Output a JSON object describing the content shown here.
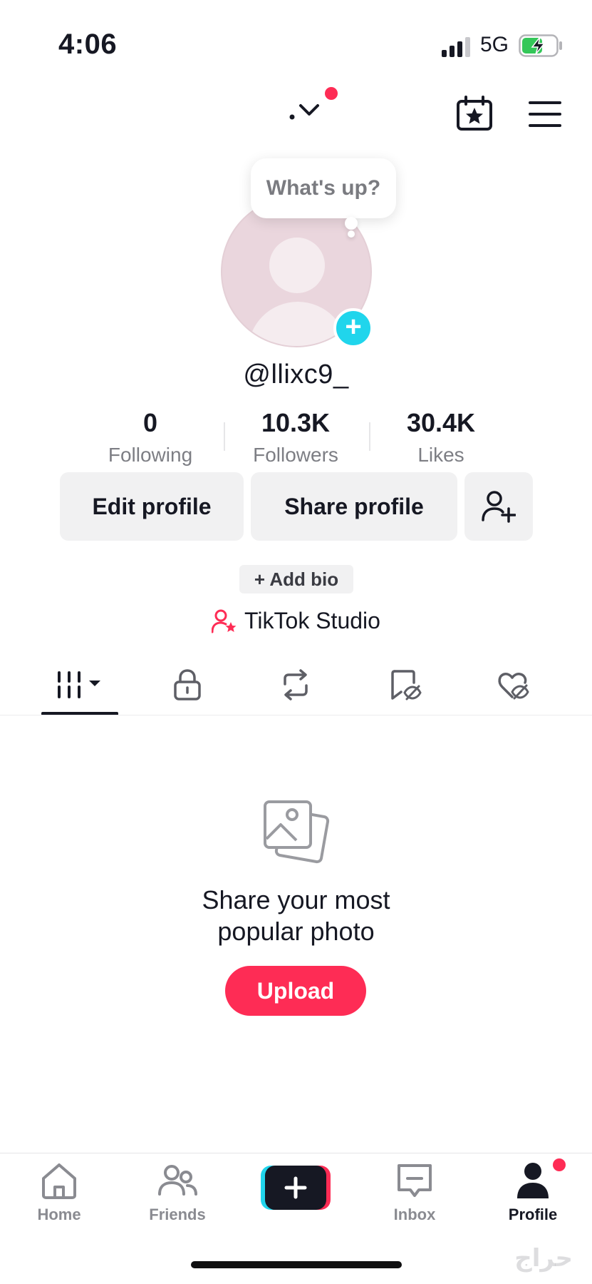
{
  "status_bar": {
    "time": "4:06",
    "network": "5G"
  },
  "bubble": {
    "text": "What's up?"
  },
  "profile": {
    "username": "@llixc9_",
    "stats": [
      {
        "value": "0",
        "label": "Following"
      },
      {
        "value": "10.3K",
        "label": "Followers"
      },
      {
        "value": "30.4K",
        "label": "Likes"
      }
    ],
    "edit_label": "Edit profile",
    "share_label": "Share profile",
    "add_bio_label": "+ Add bio",
    "studio_label": "TikTok Studio"
  },
  "tabs": [
    {
      "name": "videos",
      "icon": "grid-icon",
      "active": true
    },
    {
      "name": "private",
      "icon": "lock-icon"
    },
    {
      "name": "reposts",
      "icon": "repost-icon"
    },
    {
      "name": "favorites",
      "icon": "bookmark-hidden-icon"
    },
    {
      "name": "liked",
      "icon": "heart-hidden-icon"
    }
  ],
  "empty_state": {
    "title_line1": "Share your most",
    "title_line2": "popular photo",
    "upload_label": "Upload"
  },
  "bottom_nav": [
    {
      "label": "Home",
      "icon": "home-icon"
    },
    {
      "label": "Friends",
      "icon": "friends-icon"
    },
    {
      "label": "",
      "icon": "plus-icon"
    },
    {
      "label": "Inbox",
      "icon": "inbox-icon"
    },
    {
      "label": "Profile",
      "icon": "profile-icon",
      "active": true
    }
  ],
  "watermark": "حراج",
  "colors": {
    "accent": "#fe2c55",
    "cyan": "#20d5ec",
    "text": "#161823",
    "muted": "#7d7e84"
  }
}
